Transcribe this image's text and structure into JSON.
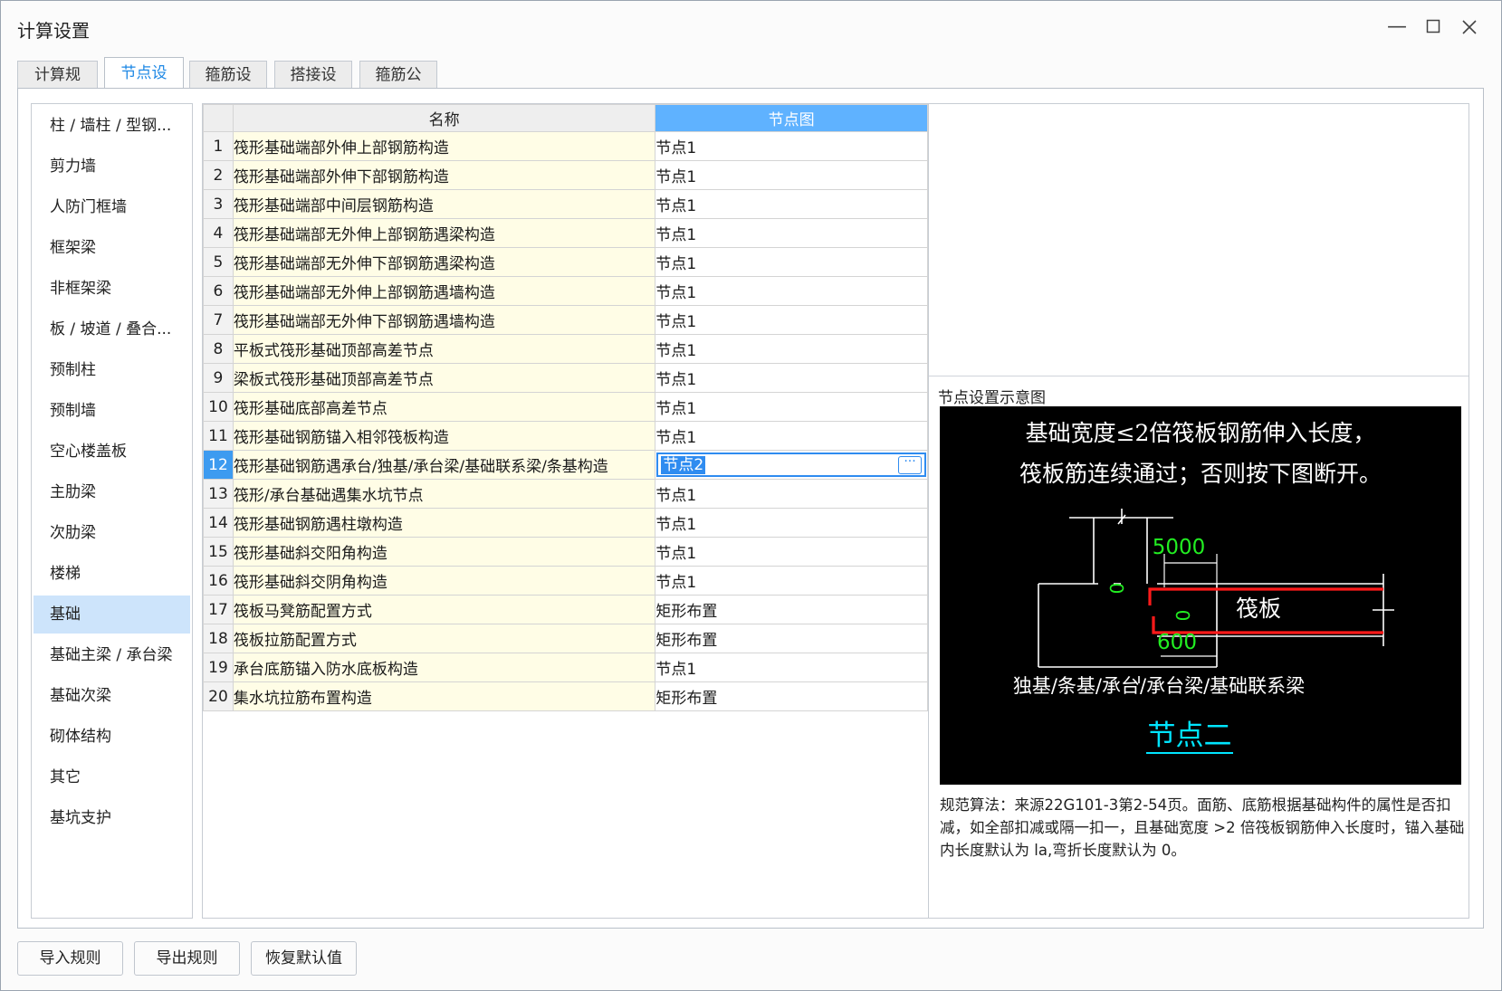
{
  "window": {
    "title": "计算设置"
  },
  "tabs": [
    {
      "label": "计算规则"
    },
    {
      "label": "节点设置"
    },
    {
      "label": "箍筋设置"
    },
    {
      "label": "搭接设置"
    },
    {
      "label": "箍筋公式"
    }
  ],
  "sidebar": {
    "items": [
      {
        "label": "柱 / 墙柱 / 型钢..."
      },
      {
        "label": "剪力墙"
      },
      {
        "label": "人防门框墙"
      },
      {
        "label": "框架梁"
      },
      {
        "label": "非框架梁"
      },
      {
        "label": "板 / 坡道 / 叠合..."
      },
      {
        "label": "预制柱"
      },
      {
        "label": "预制墙"
      },
      {
        "label": "空心楼盖板"
      },
      {
        "label": "主肋梁"
      },
      {
        "label": "次肋梁"
      },
      {
        "label": "楼梯"
      },
      {
        "label": "基础"
      },
      {
        "label": "基础主梁 / 承台梁"
      },
      {
        "label": "基础次梁"
      },
      {
        "label": "砌体结构"
      },
      {
        "label": "其它"
      },
      {
        "label": "基坑支护"
      }
    ]
  },
  "grid": {
    "headers": {
      "name": "名称",
      "node": "节点图"
    },
    "rows": [
      {
        "idx": "1",
        "name": "筏形基础端部外伸上部钢筋构造",
        "value": "节点1"
      },
      {
        "idx": "2",
        "name": "筏形基础端部外伸下部钢筋构造",
        "value": "节点1"
      },
      {
        "idx": "3",
        "name": "筏形基础端部中间层钢筋构造",
        "value": "节点1"
      },
      {
        "idx": "4",
        "name": "筏形基础端部无外伸上部钢筋遇梁构造",
        "value": "节点1"
      },
      {
        "idx": "5",
        "name": "筏形基础端部无外伸下部钢筋遇梁构造",
        "value": "节点1"
      },
      {
        "idx": "6",
        "name": "筏形基础端部无外伸上部钢筋遇墙构造",
        "value": "节点1"
      },
      {
        "idx": "7",
        "name": "筏形基础端部无外伸下部钢筋遇墙构造",
        "value": "节点1"
      },
      {
        "idx": "8",
        "name": "平板式筏形基础顶部高差节点",
        "value": "节点1"
      },
      {
        "idx": "9",
        "name": "梁板式筏形基础顶部高差节点",
        "value": "节点1"
      },
      {
        "idx": "10",
        "name": "筏形基础底部高差节点",
        "value": "节点1"
      },
      {
        "idx": "11",
        "name": "筏形基础钢筋锚入相邻筏板构造",
        "value": "节点1"
      },
      {
        "idx": "12",
        "name": "筏形基础钢筋遇承台/独基/承台梁/基础联系梁/条基构造",
        "value": "节点2"
      },
      {
        "idx": "13",
        "name": "筏形/承台基础遇集水坑节点",
        "value": "节点1"
      },
      {
        "idx": "14",
        "name": "筏形基础钢筋遇柱墩构造",
        "value": "节点1"
      },
      {
        "idx": "15",
        "name": "筏形基础斜交阳角构造",
        "value": "节点1"
      },
      {
        "idx": "16",
        "name": "筏形基础斜交阴角构造",
        "value": "节点1"
      },
      {
        "idx": "17",
        "name": "筏板马凳筋配置方式",
        "value": "矩形布置"
      },
      {
        "idx": "18",
        "name": "筏板拉筋配置方式",
        "value": "矩形布置"
      },
      {
        "idx": "19",
        "name": "承台底筋锚入防水底板构造",
        "value": "节点1"
      },
      {
        "idx": "20",
        "name": "集水坑拉筋布置构造",
        "value": "矩形布置"
      }
    ]
  },
  "preview": {
    "title": "节点设置示意图",
    "diagram": {
      "line1": "基础宽度≤2倍筏板钢筋伸入长度，",
      "line2": "筏板筋连续通过；否则按下图断开。",
      "dim_top": "5000",
      "dim_bottom": "600",
      "zero_left": "0",
      "zero_right": "0",
      "slab_label": "筏板",
      "base_label": "独基/条基/承台/承台梁/基础联系梁",
      "node_label": "节点二"
    },
    "description": "规范算法：来源22G101-3第2-54页。面筋、底筋根据基础构件的属性是否扣减，如全部扣减或隔一扣一，且基础宽度 >2 倍筏板钢筋伸入长度时，锚入基础内长度默认为 la,弯折长度默认为 0。"
  },
  "buttons": {
    "import": "导入规则",
    "export": "导出规则",
    "restore": "恢复默认值"
  },
  "colors": {
    "accent": "#1e88e5",
    "header_selected": "#5fb2ff",
    "name_cell_bg": "#fffde6",
    "sidebar_selected": "#cde4fb",
    "diagram_red": "#ff1a1a",
    "diagram_green": "#22ee22",
    "diagram_cyan": "#00e5ff"
  }
}
